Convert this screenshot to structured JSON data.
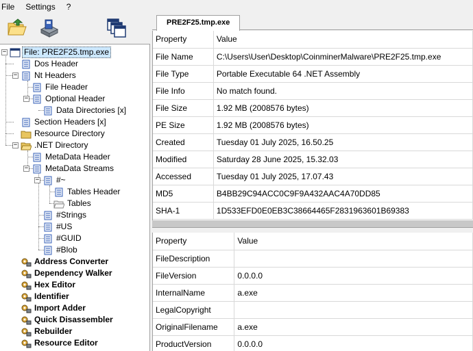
{
  "menu": {
    "file": "File",
    "settings": "Settings",
    "help": "?"
  },
  "toolbar": {
    "open_icon": "open-folder-icon",
    "save_icon": "save-disk-icon",
    "windows_icon": "windows-cascade-icon"
  },
  "tree": {
    "root": "File: PRE2F25.tmp.exe",
    "dos_header": "Dos Header",
    "nt_headers": "Nt Headers",
    "file_header": "File Header",
    "optional_header": "Optional Header",
    "data_directories": "Data Directories [x]",
    "section_headers": "Section Headers [x]",
    "resource_directory": "Resource Directory",
    "net_directory": ".NET Directory",
    "metadata_header": "MetaData Header",
    "metadata_streams": "MetaData Streams",
    "tilde": "#~",
    "tables_header": "Tables Header",
    "tables": "Tables",
    "strings": "#Strings",
    "us": "#US",
    "guid": "#GUID",
    "blob": "#Blob",
    "address_converter": "Address Converter",
    "dependency_walker": "Dependency Walker",
    "hex_editor": "Hex Editor",
    "identifier": "Identifier",
    "import_adder": "Import Adder",
    "quick_disassembler": "Quick Disassembler",
    "rebuilder": "Rebuilder",
    "resource_editor": "Resource Editor"
  },
  "tab": {
    "label": "PRE2F25.tmp.exe"
  },
  "file_info": {
    "headers": [
      "Property",
      "Value"
    ],
    "rows": [
      [
        "File Name",
        "C:\\Users\\User\\Desktop\\CoinminerMalware\\PRE2F25.tmp.exe"
      ],
      [
        "File Type",
        "Portable Executable 64 .NET Assembly"
      ],
      [
        "File Info",
        "No match found."
      ],
      [
        "File Size",
        "1.92 MB (2008576 bytes)"
      ],
      [
        "PE Size",
        "1.92 MB (2008576 bytes)"
      ],
      [
        "Created",
        "Tuesday 01 July 2025, 16.50.25"
      ],
      [
        "Modified",
        "Saturday 28 June 2025, 15.32.03"
      ],
      [
        "Accessed",
        "Tuesday 01 July 2025, 17.07.43"
      ],
      [
        "MD5",
        "B4BB29C94ACC0C9F9A432AAC4A70DD85"
      ],
      [
        "SHA-1",
        "1D533EFD0E0EB3C38664465F2831963601B69383"
      ]
    ]
  },
  "version_info": {
    "headers": [
      "Property",
      "Value"
    ],
    "rows": [
      [
        "FileDescription",
        ""
      ],
      [
        "FileVersion",
        "0.0.0.0"
      ],
      [
        "InternalName",
        "a.exe"
      ],
      [
        "LegalCopyright",
        ""
      ],
      [
        "OriginalFilename",
        "a.exe"
      ],
      [
        "ProductVersion",
        "0.0.0.0"
      ]
    ]
  },
  "colors": {
    "selection": "#cce8ff",
    "folder": "#e8c560",
    "grid_line": "#d8d8d8"
  }
}
